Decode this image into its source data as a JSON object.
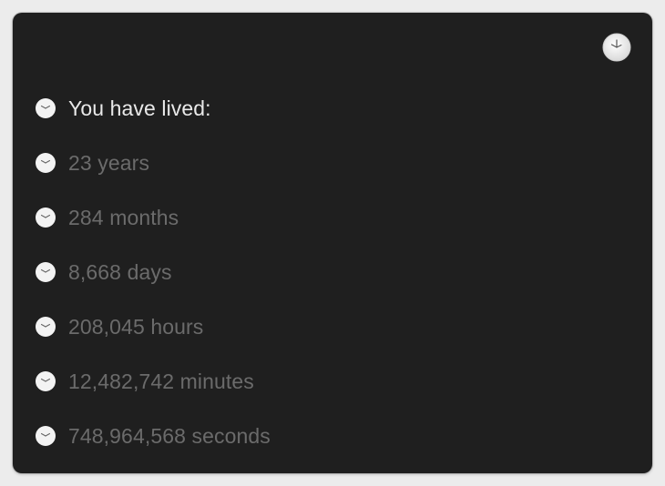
{
  "widget": {
    "heading": "You have lived:",
    "stats": [
      {
        "value": "23",
        "unit": "years"
      },
      {
        "value": "284",
        "unit": "months"
      },
      {
        "value": "8,668",
        "unit": "days"
      },
      {
        "value": "208,045",
        "unit": "hours"
      },
      {
        "value": "12,482,742",
        "unit": "minutes"
      },
      {
        "value": "748,964,568",
        "unit": "seconds"
      }
    ],
    "icons": {
      "header": "clock-icon",
      "bullet": "clock-icon"
    },
    "colors": {
      "panel_background": "#1f1f1f",
      "heading_text": "#e9e9e9",
      "stat_text": "#6b6b6b",
      "clock_face": "#f3f3f3"
    }
  }
}
